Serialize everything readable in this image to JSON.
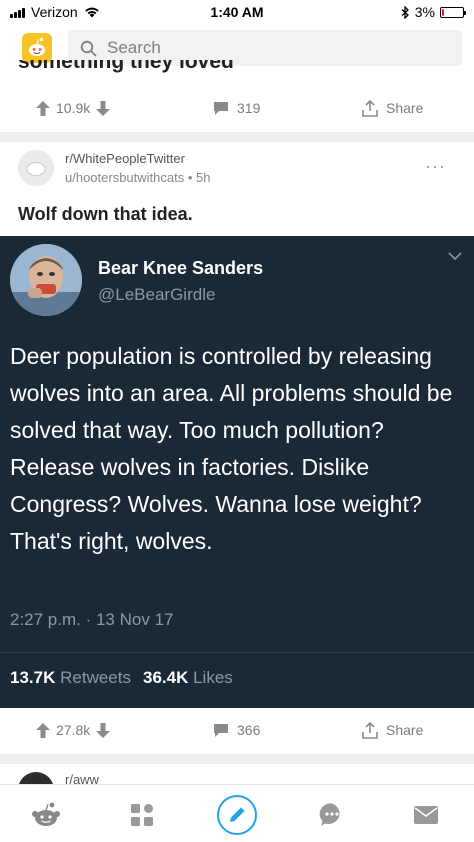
{
  "status": {
    "carrier": "Verizon",
    "time": "1:40 AM",
    "battery": "3%",
    "battery_level": 0.03
  },
  "search": {
    "placeholder": "Search"
  },
  "previous_post": {
    "title_fragment": "something they loved",
    "upvotes": "10.9k",
    "comments": "319",
    "share_label": "Share"
  },
  "post": {
    "subreddit": "r/WhitePeopleTwitter",
    "user": "u/hootersbutwithcats",
    "age": "5h",
    "title": "Wolf down that idea.",
    "upvotes": "27.8k",
    "comments": "366",
    "share_label": "Share"
  },
  "tweet": {
    "name": "Bear Knee Sanders",
    "handle": "@LeBearGirdle",
    "text": "Deer population is controlled by releasing wolves into an area. All problems should be solved that way. Too much pollution? Release wolves in factories. Dislike Congress? Wolves. Wanna lose weight? That's right, wolves.",
    "timestamp": "2:27 p.m. · 13 Nov 17",
    "retweets_count": "13.7K",
    "retweets_label": "Retweets",
    "likes_count": "36.4K",
    "likes_label": "Likes"
  },
  "next_post": {
    "subreddit": "r/aww"
  },
  "colors": {
    "tweet_bg": "#1b2836",
    "accent_blue": "#24a0ed",
    "muted_gray": "#7c7c7c",
    "logo_yellow": "#f7c325"
  },
  "icons": {
    "tabs": [
      "reddit-home-icon",
      "grid-icon",
      "pencil-icon",
      "chat-icon",
      "mail-icon"
    ]
  }
}
